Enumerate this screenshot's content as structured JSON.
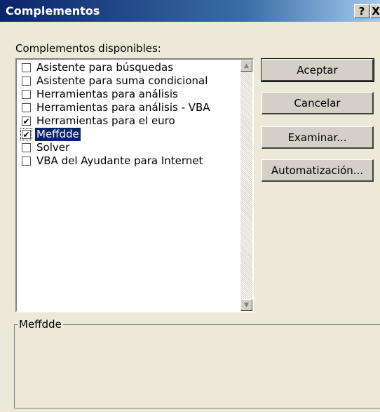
{
  "window": {
    "title": "Complementos",
    "help_label": "?",
    "close_label": "X"
  },
  "available_label": "Complementos disponibles:",
  "addins": [
    {
      "label": "Asistente para búsquedas",
      "checked": false,
      "selected": false
    },
    {
      "label": "Asistente para suma condicional",
      "checked": false,
      "selected": false
    },
    {
      "label": "Herramientas para análisis",
      "checked": false,
      "selected": false
    },
    {
      "label": "Herramientas para análisis - VBA",
      "checked": false,
      "selected": false
    },
    {
      "label": "Herramientas para el euro",
      "checked": true,
      "selected": false
    },
    {
      "label": "Meffdde",
      "checked": true,
      "selected": true
    },
    {
      "label": "Solver",
      "checked": false,
      "selected": false
    },
    {
      "label": "VBA del Ayudante para Internet",
      "checked": false,
      "selected": false
    }
  ],
  "buttons": {
    "accept": "Aceptar",
    "cancel": "Cancelar",
    "browse": "Examinar...",
    "automation": "Automatización..."
  },
  "description": {
    "title": "Meffdde",
    "text": ""
  },
  "colors": {
    "titlebar": "#0a246a",
    "selection": "#0a246a",
    "face": "#ece9d8"
  }
}
